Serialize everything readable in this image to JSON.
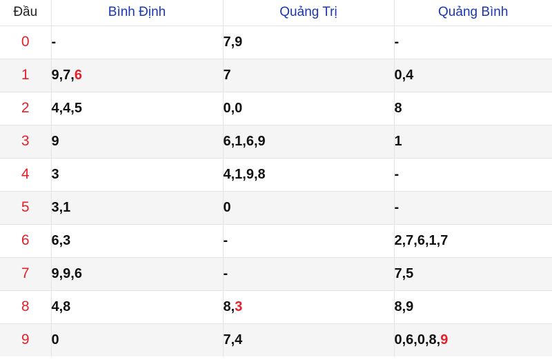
{
  "headers": [
    "Đầu",
    "Bình Định",
    "Quảng Trị",
    "Quảng Bình"
  ],
  "colors": {
    "header_link": "#1a36b4",
    "highlight": "#e5202a",
    "row_alt": "#f5f5f5"
  },
  "rows": [
    {
      "dau": "0",
      "cells": [
        {
          "text": "-",
          "hl": ""
        },
        {
          "text": "7,9",
          "hl": ""
        },
        {
          "text": "-",
          "hl": ""
        }
      ]
    },
    {
      "dau": "1",
      "cells": [
        {
          "text": "9,7,",
          "hl": "6"
        },
        {
          "text": "7",
          "hl": ""
        },
        {
          "text": "0,4",
          "hl": ""
        }
      ]
    },
    {
      "dau": "2",
      "cells": [
        {
          "text": "4,4,5",
          "hl": ""
        },
        {
          "text": "0,0",
          "hl": ""
        },
        {
          "text": "8",
          "hl": ""
        }
      ]
    },
    {
      "dau": "3",
      "cells": [
        {
          "text": "9",
          "hl": ""
        },
        {
          "text": "6,1,6,9",
          "hl": ""
        },
        {
          "text": "1",
          "hl": ""
        }
      ]
    },
    {
      "dau": "4",
      "cells": [
        {
          "text": "3",
          "hl": ""
        },
        {
          "text": "4,1,9,8",
          "hl": ""
        },
        {
          "text": "-",
          "hl": ""
        }
      ]
    },
    {
      "dau": "5",
      "cells": [
        {
          "text": "3,1",
          "hl": ""
        },
        {
          "text": "0",
          "hl": ""
        },
        {
          "text": "-",
          "hl": ""
        }
      ]
    },
    {
      "dau": "6",
      "cells": [
        {
          "text": "6,3",
          "hl": ""
        },
        {
          "text": "-",
          "hl": ""
        },
        {
          "text": "2,7,6,1,7",
          "hl": ""
        }
      ]
    },
    {
      "dau": "7",
      "cells": [
        {
          "text": "9,9,6",
          "hl": ""
        },
        {
          "text": "-",
          "hl": ""
        },
        {
          "text": "7,5",
          "hl": ""
        }
      ]
    },
    {
      "dau": "8",
      "cells": [
        {
          "text": "4,8",
          "hl": ""
        },
        {
          "text": "8,",
          "hl": "3"
        },
        {
          "text": "8,9",
          "hl": ""
        }
      ]
    },
    {
      "dau": "9",
      "cells": [
        {
          "text": "0",
          "hl": ""
        },
        {
          "text": "7,4",
          "hl": ""
        },
        {
          "text": "0,6,0,8,",
          "hl": "9"
        }
      ]
    }
  ]
}
